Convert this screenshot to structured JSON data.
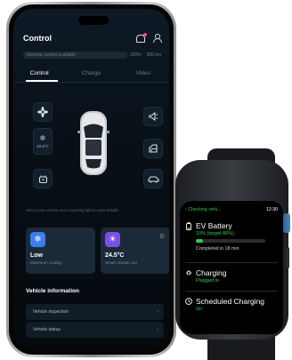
{
  "phone": {
    "app_title": "Control",
    "status": {
      "remote": "Remote control available",
      "battery_pct": "100%",
      "range": "999 km"
    },
    "tabs": [
      "Control",
      "Charge",
      "Video"
    ],
    "active_tab": 0,
    "controls": {
      "fan_icon": "fan-icon",
      "temp_icon": "settings-icon",
      "temp_label": "20.5°C",
      "seat_icon": "seat-heat-icon",
      "horn_icon": "horn-icon",
      "window_icon": "window-icon",
      "trunk_icon": "trunk-icon",
      "lock_icon": "lock-icon"
    },
    "hint": "Select your vehicle and a warning light to view details",
    "cards": [
      {
        "icon": "snowflake-icon",
        "value": "Low",
        "sub": "Maximum cooling",
        "color": "#3b7cf2"
      },
      {
        "icon": "climate-icon",
        "value": "24.5°C",
        "sub": "Smart climate con",
        "color": "#7b4fe6"
      }
    ],
    "vehicle_info_title": "Vehicle information",
    "vehicle_info_items": [
      "Vehicle inspection",
      "Vehicle status"
    ]
  },
  "watch": {
    "back_label": "‹ Checking vehi...",
    "time": "12:30",
    "battery": {
      "title": "EV Battery",
      "sub": "10% (target 80%)",
      "progress": 0.1,
      "completed": "Completed in 18 min"
    },
    "charging": {
      "title": "Charging",
      "sub": "Plugged in"
    },
    "scheduled": {
      "title": "Scheduled Charging",
      "sub": "On"
    },
    "accent": "#34c759"
  }
}
